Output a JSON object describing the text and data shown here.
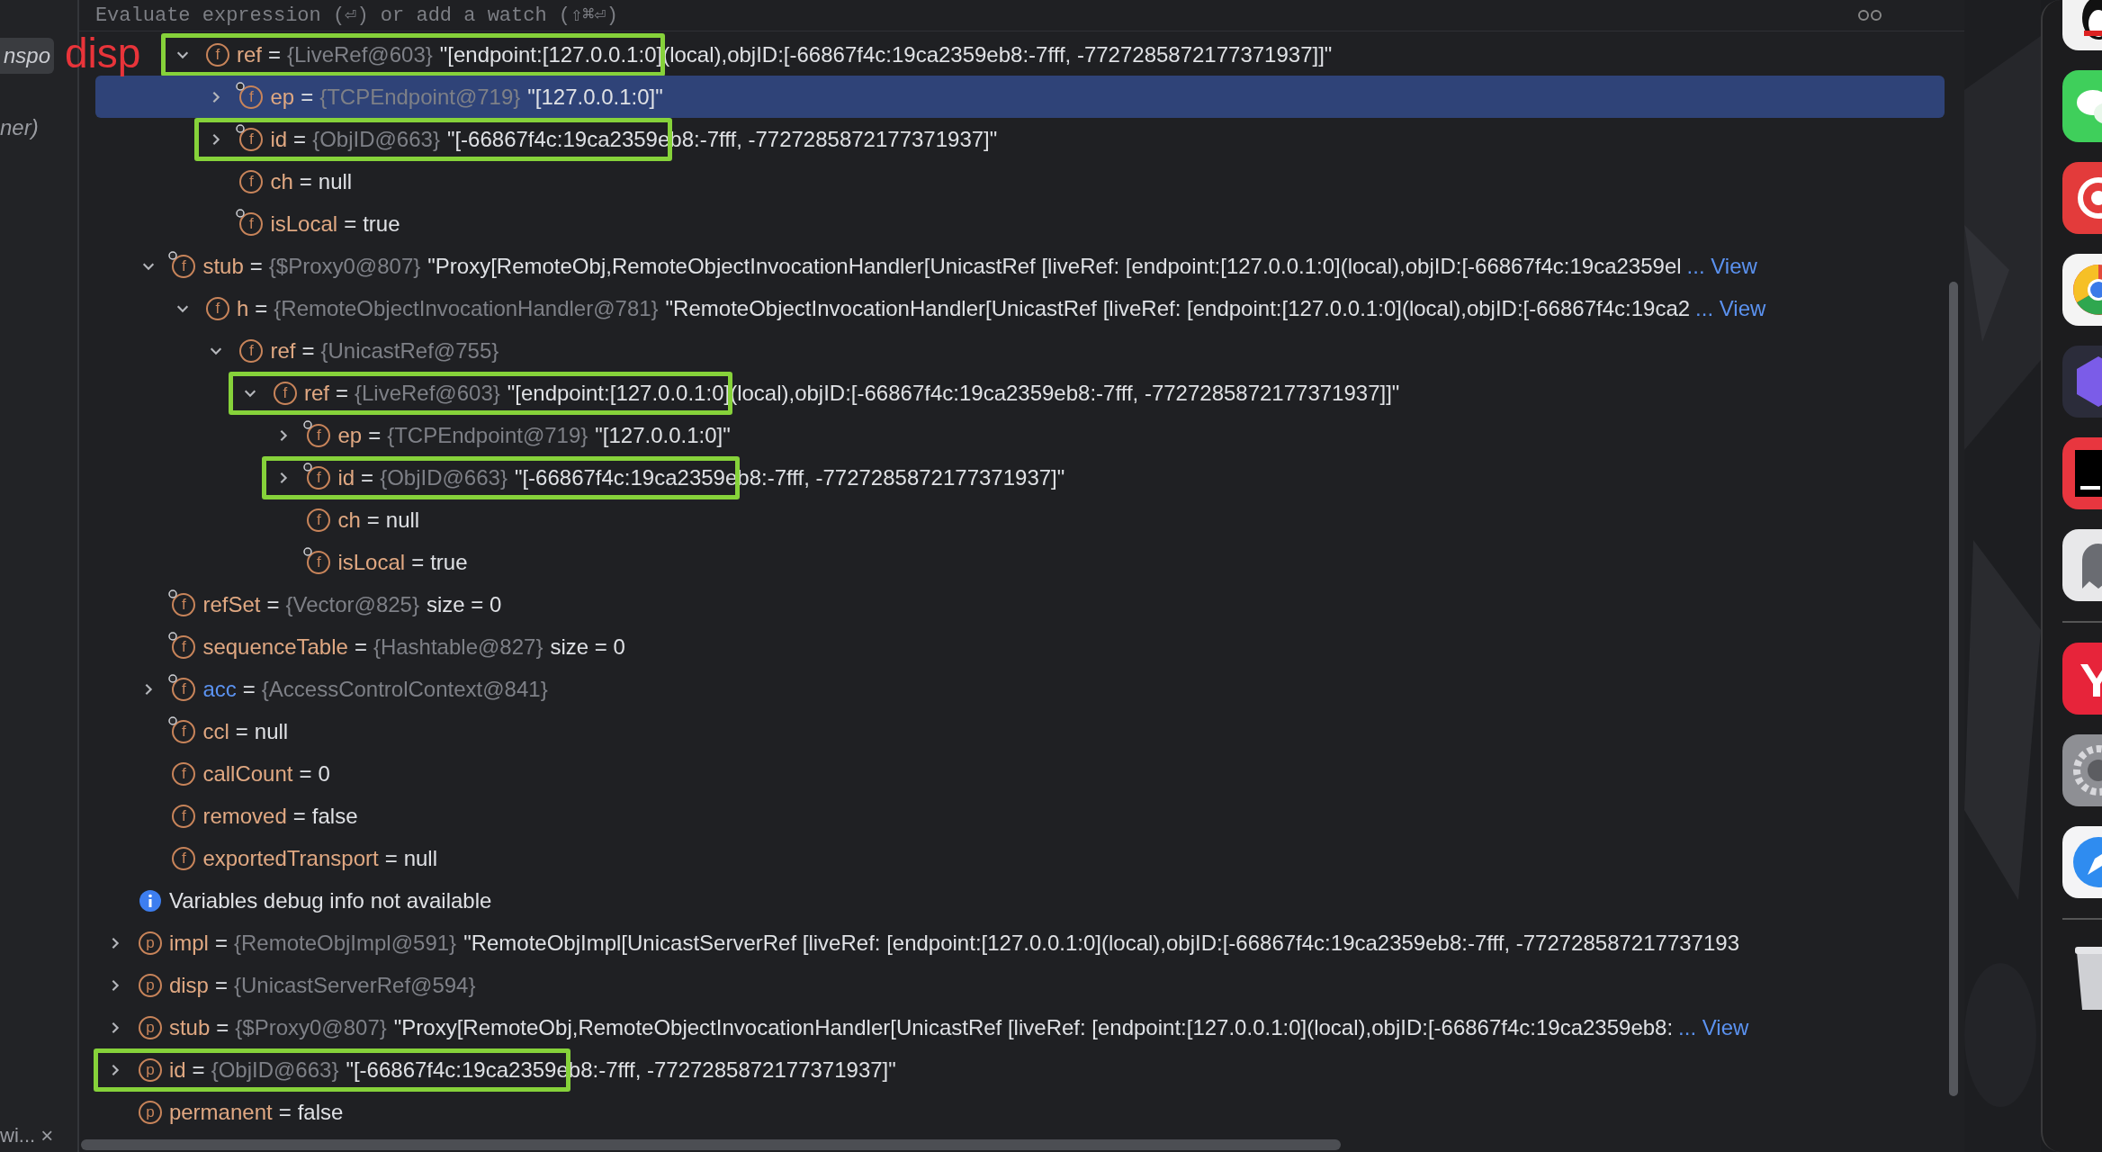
{
  "left_panel": {
    "tab": "nspo",
    "item": "ner)",
    "footer": "wi...",
    "close": "×"
  },
  "header": {
    "placeholder": "Evaluate expression (⏎) or add a watch (⇧⌘⏎)"
  },
  "annotation_label": "disp",
  "tree": [
    {
      "children": [
        {
          "children": [
            {
              "name": "ref",
              "op": "=",
              "type": "{LiveRef@603}",
              "value": "\"[endpoint:[127.0.0.1:0](local),objID:[-66867f4c:19ca2359eb8:-7fff, -7727285872177371937]]\"",
              "kind": "member",
              "icon": "f",
              "pinned": false,
              "expanded": true,
              "selected": false,
              "boxed": true,
              "children": [
                {
                  "name": "ep",
                  "op": "=",
                  "type": "{TCPEndpoint@719}",
                  "value": "\"[127.0.0.1:0]\"",
                  "kind": "member",
                  "icon": "f",
                  "pinned": true,
                  "expanded": false,
                  "selected": true,
                  "boxed": false
                },
                {
                  "name": "id",
                  "op": "=",
                  "type": "{ObjID@663}",
                  "value": "\"[-66867f4c:19ca2359eb8:-7fff, -7727285872177371937]\"",
                  "kind": "member",
                  "icon": "f",
                  "pinned": true,
                  "expanded": false,
                  "selected": false,
                  "boxed": true
                },
                {
                  "name": "ch",
                  "op": "=",
                  "value": "null",
                  "kind": "member",
                  "icon": "f",
                  "pinned": false,
                  "selected": false,
                  "boxed": false
                },
                {
                  "name": "isLocal",
                  "op": "=",
                  "value": "true",
                  "kind": "member",
                  "icon": "f",
                  "pinned": true,
                  "selected": false,
                  "boxed": false
                }
              ]
            }
          ]
        },
        {
          "name": "stub",
          "op": "=",
          "type": "{$Proxy0@807}",
          "value": "\"Proxy[RemoteObj,RemoteObjectInvocationHandler[UnicastRef [liveRef: [endpoint:[127.0.0.1:0](local),objID:[-66867f4c:19ca2359el",
          "link": "... View",
          "kind": "member",
          "icon": "f",
          "pinned": true,
          "expanded": true,
          "selected": false,
          "boxed": false,
          "children": [
            {
              "name": "h",
              "op": "=",
              "type": "{RemoteObjectInvocationHandler@781}",
              "value": "\"RemoteObjectInvocationHandler[UnicastRef [liveRef: [endpoint:[127.0.0.1:0](local),objID:[-66867f4c:19ca2",
              "link": "... View",
              "kind": "member",
              "icon": "f",
              "pinned": false,
              "expanded": true,
              "selected": false,
              "boxed": false,
              "children": [
                {
                  "name": "ref",
                  "op": "=",
                  "type": "{UnicastRef@755}",
                  "kind": "member",
                  "icon": "f",
                  "pinned": false,
                  "expanded": true,
                  "selected": false,
                  "boxed": false,
                  "children": [
                    {
                      "name": "ref",
                      "op": "=",
                      "type": "{LiveRef@603}",
                      "value": "\"[endpoint:[127.0.0.1:0](local),objID:[-66867f4c:19ca2359eb8:-7fff, -7727285872177371937]]\"",
                      "kind": "member",
                      "icon": "f",
                      "pinned": false,
                      "expanded": true,
                      "selected": false,
                      "boxed": true,
                      "children": [
                        {
                          "name": "ep",
                          "op": "=",
                          "type": "{TCPEndpoint@719}",
                          "value": "\"[127.0.0.1:0]\"",
                          "kind": "member",
                          "icon": "f",
                          "pinned": true,
                          "expanded": false,
                          "selected": false,
                          "boxed": false
                        },
                        {
                          "name": "id",
                          "op": "=",
                          "type": "{ObjID@663}",
                          "value": "\"[-66867f4c:19ca2359eb8:-7fff, -7727285872177371937]\"",
                          "kind": "member",
                          "icon": "f",
                          "pinned": true,
                          "expanded": false,
                          "selected": false,
                          "boxed": true
                        },
                        {
                          "name": "ch",
                          "op": "=",
                          "value": "null",
                          "kind": "member",
                          "icon": "f",
                          "pinned": false,
                          "selected": false,
                          "boxed": false
                        },
                        {
                          "name": "isLocal",
                          "op": "=",
                          "value": "true",
                          "kind": "member",
                          "icon": "f",
                          "pinned": true,
                          "selected": false,
                          "boxed": false
                        }
                      ]
                    }
                  ]
                }
              ]
            }
          ]
        },
        {
          "name": "refSet",
          "op": "=",
          "type": "{Vector@825}",
          "value": "size = 0",
          "kind": "member",
          "icon": "f",
          "pinned": true,
          "selected": false,
          "boxed": false
        },
        {
          "name": "sequenceTable",
          "op": "=",
          "type": "{Hashtable@827}",
          "value": "size = 0",
          "kind": "member",
          "icon": "f",
          "pinned": true,
          "selected": false,
          "boxed": false
        },
        {
          "name": "acc",
          "op": "=",
          "type": "{AccessControlContext@841}",
          "kind": "member",
          "icon": "f",
          "pinned": true,
          "highlight": true,
          "expanded": false,
          "selected": false,
          "boxed": false
        },
        {
          "name": "ccl",
          "op": "=",
          "value": "null",
          "kind": "member",
          "icon": "f",
          "pinned": true,
          "selected": false,
          "boxed": false
        },
        {
          "name": "callCount",
          "op": "=",
          "value": "0",
          "kind": "member",
          "icon": "f",
          "pinned": false,
          "selected": false,
          "boxed": false
        },
        {
          "name": "removed",
          "op": "=",
          "value": "false",
          "kind": "member",
          "icon": "f",
          "pinned": false,
          "selected": false,
          "boxed": false
        },
        {
          "name": "exportedTransport",
          "op": "=",
          "value": "null",
          "kind": "member",
          "icon": "f",
          "pinned": false,
          "selected": false,
          "boxed": false
        }
      ]
    },
    {
      "name": "Variables debug info not available",
      "kind": "info",
      "selected": false,
      "boxed": false
    },
    {
      "name": "impl",
      "op": "=",
      "type": "{RemoteObjImpl@591}",
      "value": "\"RemoteObjImpl[UnicastServerRef [liveRef: [endpoint:[127.0.0.1:0](local),objID:[-66867f4c:19ca2359eb8:-7fff, -772728587217737193",
      "kind": "member",
      "icon": "p",
      "pinned": false,
      "expanded": false,
      "selected": false,
      "boxed": false
    },
    {
      "name": "disp",
      "op": "=",
      "type": "{UnicastServerRef@594}",
      "kind": "member",
      "icon": "p",
      "pinned": false,
      "expanded": false,
      "selected": false,
      "boxed": false
    },
    {
      "name": "stub",
      "op": "=",
      "type": "{$Proxy0@807}",
      "value": "\"Proxy[RemoteObj,RemoteObjectInvocationHandler[UnicastRef [liveRef: [endpoint:[127.0.0.1:0](local),objID:[-66867f4c:19ca2359eb8:",
      "link": "... View",
      "kind": "member",
      "icon": "p",
      "pinned": false,
      "expanded": false,
      "selected": false,
      "boxed": false
    },
    {
      "name": "id",
      "op": "=",
      "type": "{ObjID@663}",
      "value": "\"[-66867f4c:19ca2359eb8:-7fff, -7727285872177371937]\"",
      "kind": "member",
      "icon": "p",
      "pinned": false,
      "expanded": false,
      "selected": false,
      "boxed": true
    },
    {
      "name": "permanent",
      "op": "=",
      "value": "false",
      "kind": "member",
      "icon": "p",
      "pinned": false,
      "selected": false,
      "boxed": false
    }
  ]
}
